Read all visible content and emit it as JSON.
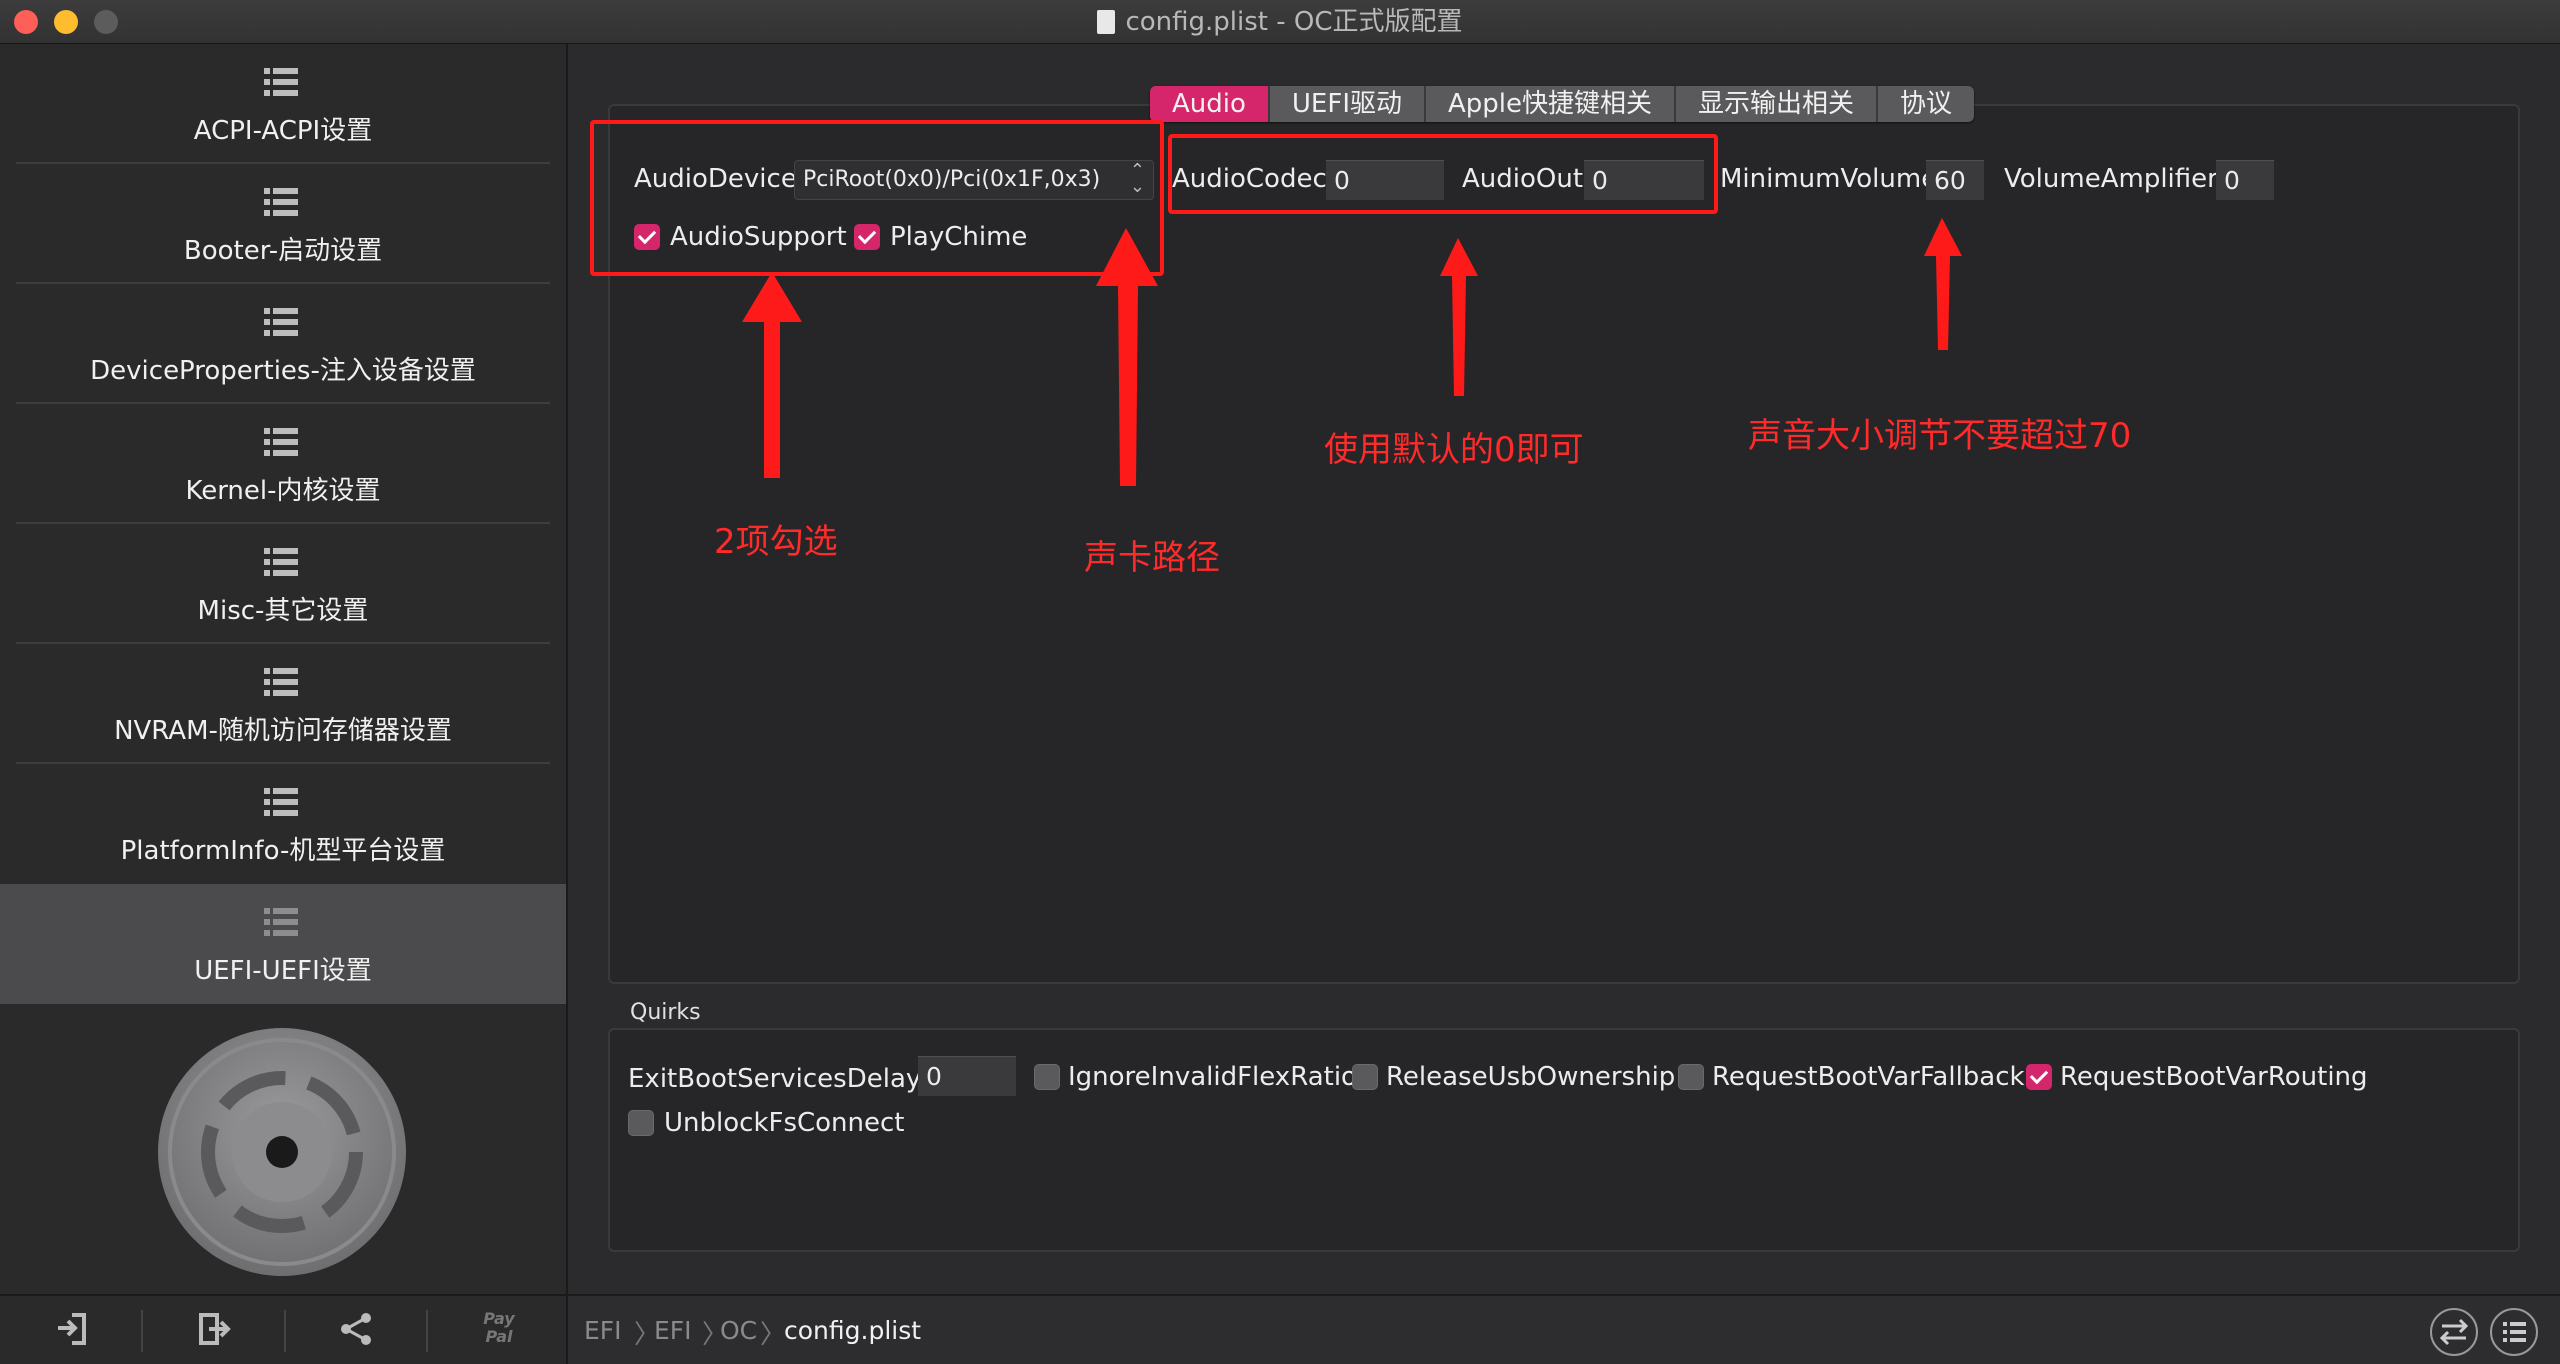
{
  "window": {
    "title": "config.plist - OC正式版配置"
  },
  "sidebar": {
    "items": [
      {
        "label": "ACPI-ACPI设置"
      },
      {
        "label": "Booter-启动设置"
      },
      {
        "label": "DeviceProperties-注入设备设置"
      },
      {
        "label": "Kernel-内核设置"
      },
      {
        "label": "Misc-其它设置"
      },
      {
        "label": "NVRAM-随机访问存储器设置"
      },
      {
        "label": "PlatformInfo-机型平台设置"
      },
      {
        "label": "UEFI-UEFI设置"
      }
    ],
    "active_index": 7,
    "bottom": {
      "paypal_text": "Pay\nPal"
    }
  },
  "tabs": [
    "Audio",
    "UEFI驱动",
    "Apple快捷键相关",
    "显示输出相关",
    "协议"
  ],
  "active_tab": "Audio",
  "audio": {
    "device_label": "AudioDevice",
    "device_value": "PciRoot(0x0)/Pci(0x1F,0x3)",
    "codec_label": "AudioCodec",
    "codec_value": "0",
    "out_label": "AudioOut",
    "out_value": "0",
    "min_volume_label": "MinimumVolume",
    "min_volume_value": "60",
    "amplifier_label": "VolumeAmplifier",
    "amplifier_value": "0",
    "support_label": "AudioSupport",
    "support_checked": true,
    "chime_label": "PlayChime",
    "chime_checked": true
  },
  "annotations": {
    "two_checks": "2项勾选",
    "card_path": "声卡路径",
    "default_zero": "使用默认的0即可",
    "volume_limit": "声音大小调节不要超过70",
    "color": "#ff2a2a"
  },
  "quirks": {
    "title": "Quirks",
    "exit_delay_label": "ExitBootServicesDelay",
    "exit_delay_value": "0",
    "items": [
      {
        "label": "IgnoreInvalidFlexRatio",
        "checked": false
      },
      {
        "label": "ReleaseUsbOwnership",
        "checked": false
      },
      {
        "label": "RequestBootVarFallback",
        "checked": false
      },
      {
        "label": "RequestBootVarRouting",
        "checked": true
      },
      {
        "label": "UnblockFsConnect",
        "checked": false
      }
    ]
  },
  "breadcrumb": [
    "EFI",
    "EFI",
    "OC",
    "config.plist"
  ],
  "colors": {
    "accent": "#d6266b",
    "annotation": "#ff2a2a"
  }
}
